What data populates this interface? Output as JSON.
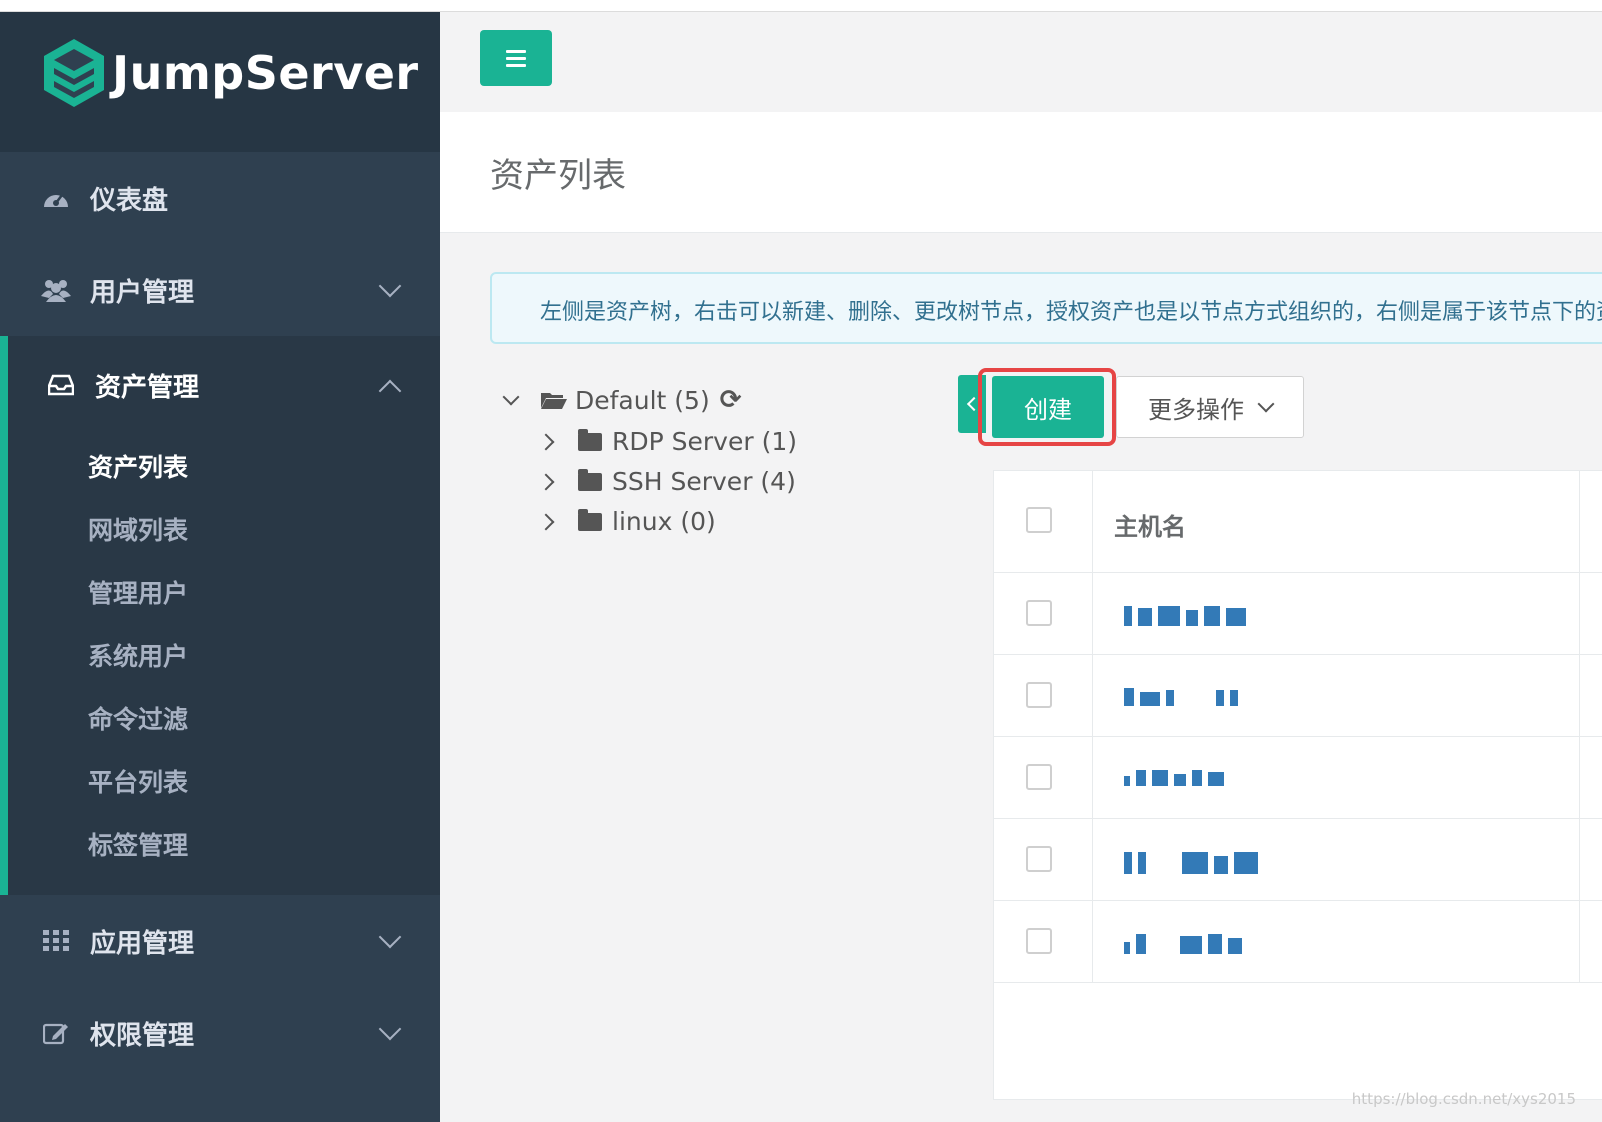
{
  "app": {
    "brand": "JumpServer"
  },
  "sidebar": {
    "items": [
      {
        "label": "仪表盘",
        "icon": "dashboard-icon",
        "expanded": false,
        "has_chevron": false
      },
      {
        "label": "用户管理",
        "icon": "users-icon",
        "expanded": false,
        "has_chevron": true
      },
      {
        "label": "资产管理",
        "icon": "inbox-icon",
        "expanded": true,
        "has_chevron": true,
        "children": [
          "资产列表",
          "网域列表",
          "管理用户",
          "系统用户",
          "命令过滤",
          "平台列表",
          "标签管理"
        ],
        "current_child": "资产列表"
      },
      {
        "label": "应用管理",
        "icon": "grid-icon",
        "expanded": false,
        "has_chevron": true
      },
      {
        "label": "权限管理",
        "icon": "edit-icon",
        "expanded": false,
        "has_chevron": true
      }
    ]
  },
  "header": {
    "menu_icon": "hamburger-icon"
  },
  "page": {
    "title": "资产列表",
    "alert": "左侧是资产树，右击可以新建、删除、更改树节点，授权资产也是以节点方式组织的，右侧是属于该节点下的资产"
  },
  "tree": {
    "root": {
      "label": "Default (5)",
      "expanded": true
    },
    "children": [
      "RDP Server (1)",
      "SSH Server (4)",
      "linux (0)"
    ]
  },
  "toolbar": {
    "create_label": "创建",
    "more_label": "更多操作"
  },
  "table": {
    "columns": [
      "主机名"
    ],
    "row_count": 5
  },
  "watermark": "https://blog.csdn.net/xys2015",
  "colors": {
    "sidebar": "#2f4050",
    "accent": "#1ab394",
    "highlight": "#e64545",
    "link": "#337ab7"
  }
}
